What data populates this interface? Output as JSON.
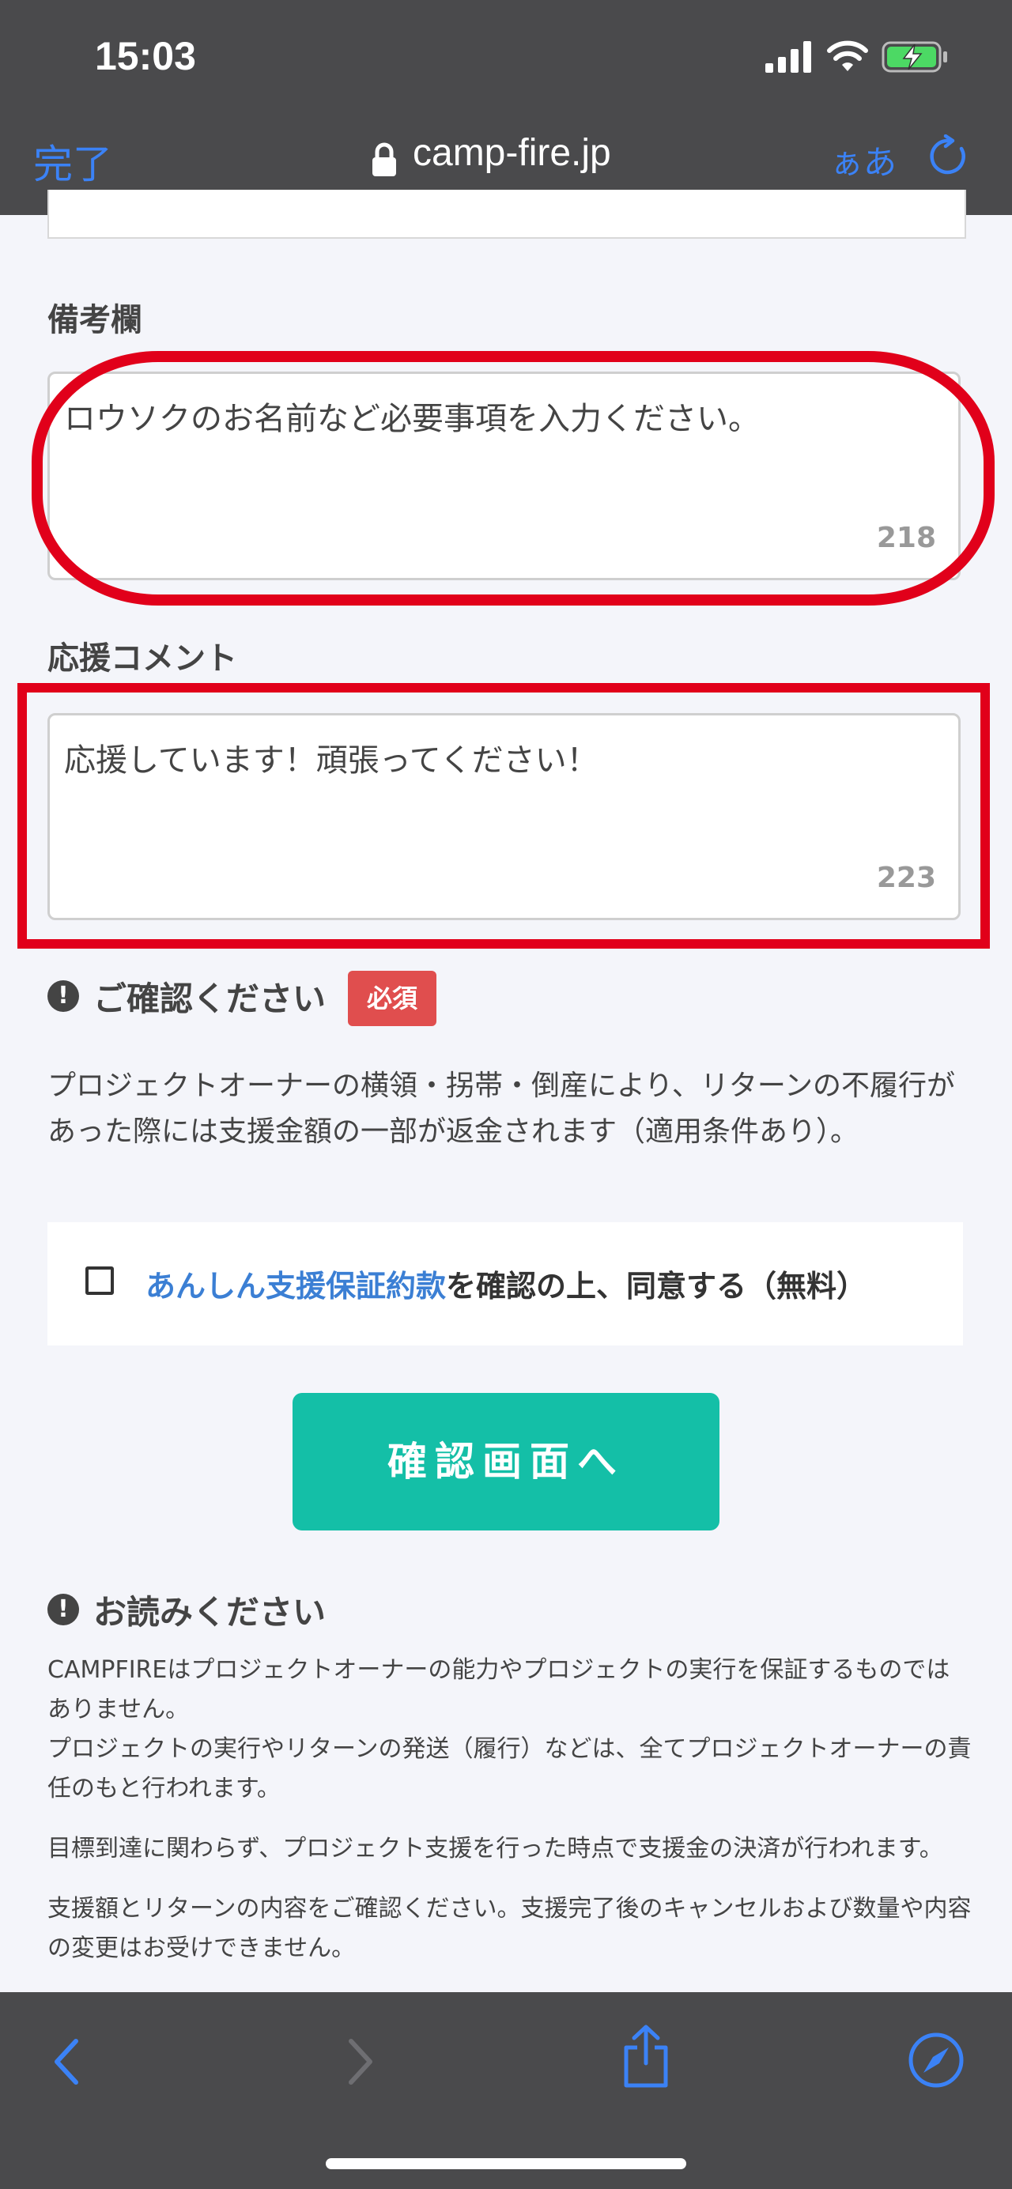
{
  "status": {
    "time": "15:03"
  },
  "browser": {
    "done": "完了",
    "domain": "camp-fire.jp",
    "text_size": "ぁあ"
  },
  "form": {
    "remarks_label": "備考欄",
    "remarks_value": "ロウソクのお名前など必要事項を入力ください。",
    "remarks_count": "218",
    "comment_label": "応援コメント",
    "comment_value": "応援しています！頑張ってください！",
    "comment_count": "223"
  },
  "confirm": {
    "title": "ご確認ください",
    "badge": "必須",
    "description": "プロジェクトオーナーの横領・拐帯・倒産により、リターンの不履行があった際には支援金額の一部が返金されます（適用条件あり）。"
  },
  "agree": {
    "link": "あんしん支援保証約款",
    "text": "を確認の上、同意する（無料）"
  },
  "cta": {
    "label": "確認画面へ"
  },
  "notice": {
    "title": "お読みください",
    "p1": "CAMPFIREはプロジェクトオーナーの能力やプロジェクトの実行を保証するものではありません。",
    "p1b": "プロジェクトの実行やリターンの発送（履行）などは、全てプロジェクトオーナーの責任のもと行われます。",
    "p2": "目標到達に関わらず、プロジェクト支援を行った時点で支援金の決済が行われます。",
    "p3": "支援額とリターンの内容をご確認ください。支援完了後のキャンセルおよび数量や内容の変更はお受けできません。"
  },
  "colors": {
    "accent": "#3b82f6",
    "cta": "#14bfa7",
    "required": "#e04e4e",
    "highlight": "#e1001a"
  }
}
